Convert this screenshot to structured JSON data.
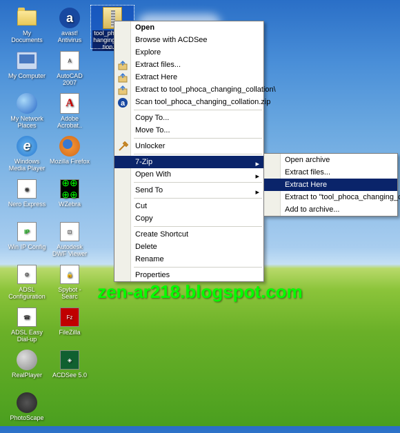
{
  "watermark": "zen-ar218.blogspot.com",
  "selected_file": "tool_phoca_changing_collation.zip",
  "desktop": {
    "icons": [
      {
        "label": "My Documents",
        "type": "folder"
      },
      {
        "label": "avast! Antivirus",
        "type": "avast"
      },
      {
        "label": "tool_phoca_changing_collation.zip",
        "type": "zip",
        "selected": true
      },
      {
        "label": "My Computer",
        "type": "computer"
      },
      {
        "label": "AutoCAD 2007",
        "type": "box",
        "text": "A"
      },
      {
        "label": "",
        "type": "blank"
      },
      {
        "label": "My Network Places",
        "type": "globe"
      },
      {
        "label": "Adobe Acrobat..",
        "type": "pdf"
      },
      {
        "label": "",
        "type": "blank"
      },
      {
        "label": "Windows Media Player",
        "type": "ie"
      },
      {
        "label": "Mozilla Firefox",
        "type": "firefox"
      },
      {
        "label": "",
        "type": "blank"
      },
      {
        "label": "Nero Express",
        "type": "box",
        "text": "◉"
      },
      {
        "label": "WZebra",
        "type": "wzebra"
      },
      {
        "label": "",
        "type": "blank"
      },
      {
        "label": "Win IP Config",
        "type": "ip"
      },
      {
        "label": "Autodesk DWF Viewer",
        "type": "box",
        "text": "⊡"
      },
      {
        "label": "",
        "type": "blank"
      },
      {
        "label": "ADSL Configuration",
        "type": "box",
        "text": "⚙"
      },
      {
        "label": "Spybot - Searc",
        "type": "box",
        "text": "🔒"
      },
      {
        "label": "",
        "type": "blank"
      },
      {
        "label": "ADSL Easy Dial-up",
        "type": "box",
        "text": "☎"
      },
      {
        "label": "FileZilla",
        "type": "box",
        "text": "Fz",
        "bg": "#c00000",
        "fg": "#fff"
      },
      {
        "label": "",
        "type": "blank"
      },
      {
        "label": "RealPlayer",
        "type": "realplayer"
      },
      {
        "label": "ACDSee 5.0",
        "type": "box",
        "text": "◈",
        "bg": "#106030",
        "fg": "#fff"
      },
      {
        "label": "",
        "type": "blank"
      },
      {
        "label": "PhotoScape",
        "type": "blank2"
      }
    ]
  },
  "context_menu": {
    "items": [
      {
        "label": "Open",
        "bold": true
      },
      {
        "label": "Browse with ACDSee"
      },
      {
        "label": "Explore"
      },
      {
        "label": "Extract files...",
        "icon": "extract"
      },
      {
        "label": "Extract Here",
        "icon": "extract"
      },
      {
        "label": "Extract to tool_phoca_changing_collation\\",
        "icon": "extract"
      },
      {
        "label": "Scan tool_phoca_changing_collation.zip",
        "icon": "avast"
      },
      {
        "sep": true
      },
      {
        "label": "Copy To..."
      },
      {
        "label": "Move To..."
      },
      {
        "sep": true
      },
      {
        "label": "Unlocker",
        "icon": "unlocker"
      },
      {
        "sep": true
      },
      {
        "label": "7-Zip",
        "submenu": true,
        "selected": true
      },
      {
        "label": "Open With",
        "submenu": true
      },
      {
        "sep": true
      },
      {
        "label": "Send To",
        "submenu": true
      },
      {
        "sep": true
      },
      {
        "label": "Cut"
      },
      {
        "label": "Copy"
      },
      {
        "sep": true
      },
      {
        "label": "Create Shortcut"
      },
      {
        "label": "Delete"
      },
      {
        "label": "Rename"
      },
      {
        "sep": true
      },
      {
        "label": "Properties"
      }
    ]
  },
  "submenu": {
    "items": [
      {
        "label": "Open archive"
      },
      {
        "label": "Extract files..."
      },
      {
        "label": "Extract Here",
        "selected": true
      },
      {
        "label": "Extract to \"tool_phoca_changing_collation\\\""
      },
      {
        "label": "Add to archive..."
      }
    ]
  }
}
